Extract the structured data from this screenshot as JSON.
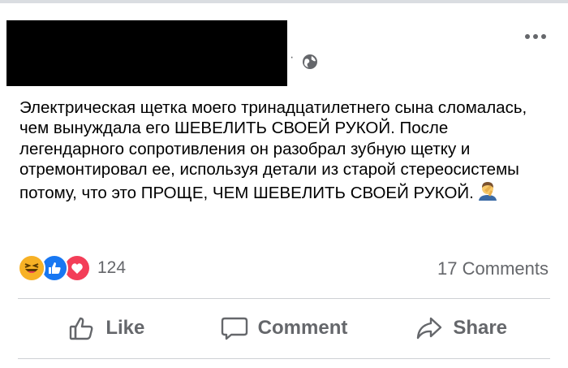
{
  "header": {
    "separator": "·",
    "privacy_icon": "globe-icon",
    "more_icon": "more-horizontal-icon"
  },
  "post": {
    "text": "Электрическая щетка моего тринадцатилетнего сына сломалась, чем вынуждала его ШЕВЕЛИТЬ СВОЕЙ РУКОЙ. После легендарного сопротивления он разобрал зубную щетку и отремонтировал ее, используя детали из старой стереосистемы потому, что это ПРОЩЕ, ЧЕМ ШЕВЕЛИТЬ СВОЕЙ РУКОЙ.",
    "emoji": "person-facepalming"
  },
  "reactions": {
    "types": [
      "haha",
      "like",
      "love"
    ],
    "count": "124",
    "comments": "17 Comments"
  },
  "actions": {
    "like_label": "Like",
    "comment_label": "Comment",
    "share_label": "Share"
  },
  "colors": {
    "like": "#1877f2",
    "love": "#f33e58",
    "haha": "#f7b125",
    "muted_text": "#65676b",
    "divider": "#ced0d4"
  }
}
